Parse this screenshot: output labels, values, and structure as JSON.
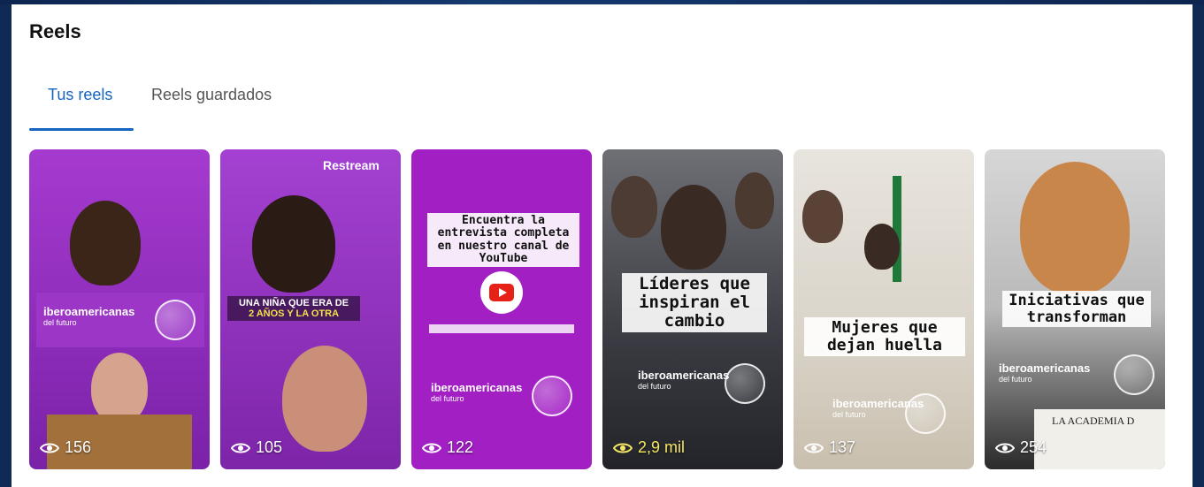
{
  "section_title": "Reels",
  "tabs": [
    {
      "label": "Tus reels",
      "active": true
    },
    {
      "label": "Reels guardados",
      "active": false
    }
  ],
  "accent_color": "#1565c0",
  "reels": [
    {
      "views": "156",
      "brand": "iberoamericanas",
      "brand_sub": "del futuro",
      "eye_icon": "eye-icon"
    },
    {
      "views": "105",
      "overlay_top": "Restream",
      "caption_line1": "UNA NIÑA QUE ERA DE",
      "caption_line2": "2 AÑOS Y LA OTRA",
      "eye_icon": "eye-icon"
    },
    {
      "views": "122",
      "caption": "Encuentra la entrevista completa en nuestro canal de YouTube",
      "brand": "iberoamericanas",
      "brand_sub": "del futuro",
      "eye_icon": "eye-icon"
    },
    {
      "views": "2,9 mil",
      "caption": "Líderes que inspiran el cambio",
      "brand": "iberoamericanas",
      "brand_sub": "del futuro",
      "eye_icon": "eye-icon"
    },
    {
      "views": "137",
      "caption": "Mujeres que dejan huella",
      "brand": "iberoamericanas",
      "brand_sub": "del futuro",
      "eye_icon": "eye-icon"
    },
    {
      "views": "254",
      "caption": "Iniciativas que transforman",
      "brand": "iberoamericanas",
      "brand_sub": "del futuro",
      "footer_text": "LA ACADEMIA D",
      "eye_icon": "eye-icon"
    }
  ]
}
